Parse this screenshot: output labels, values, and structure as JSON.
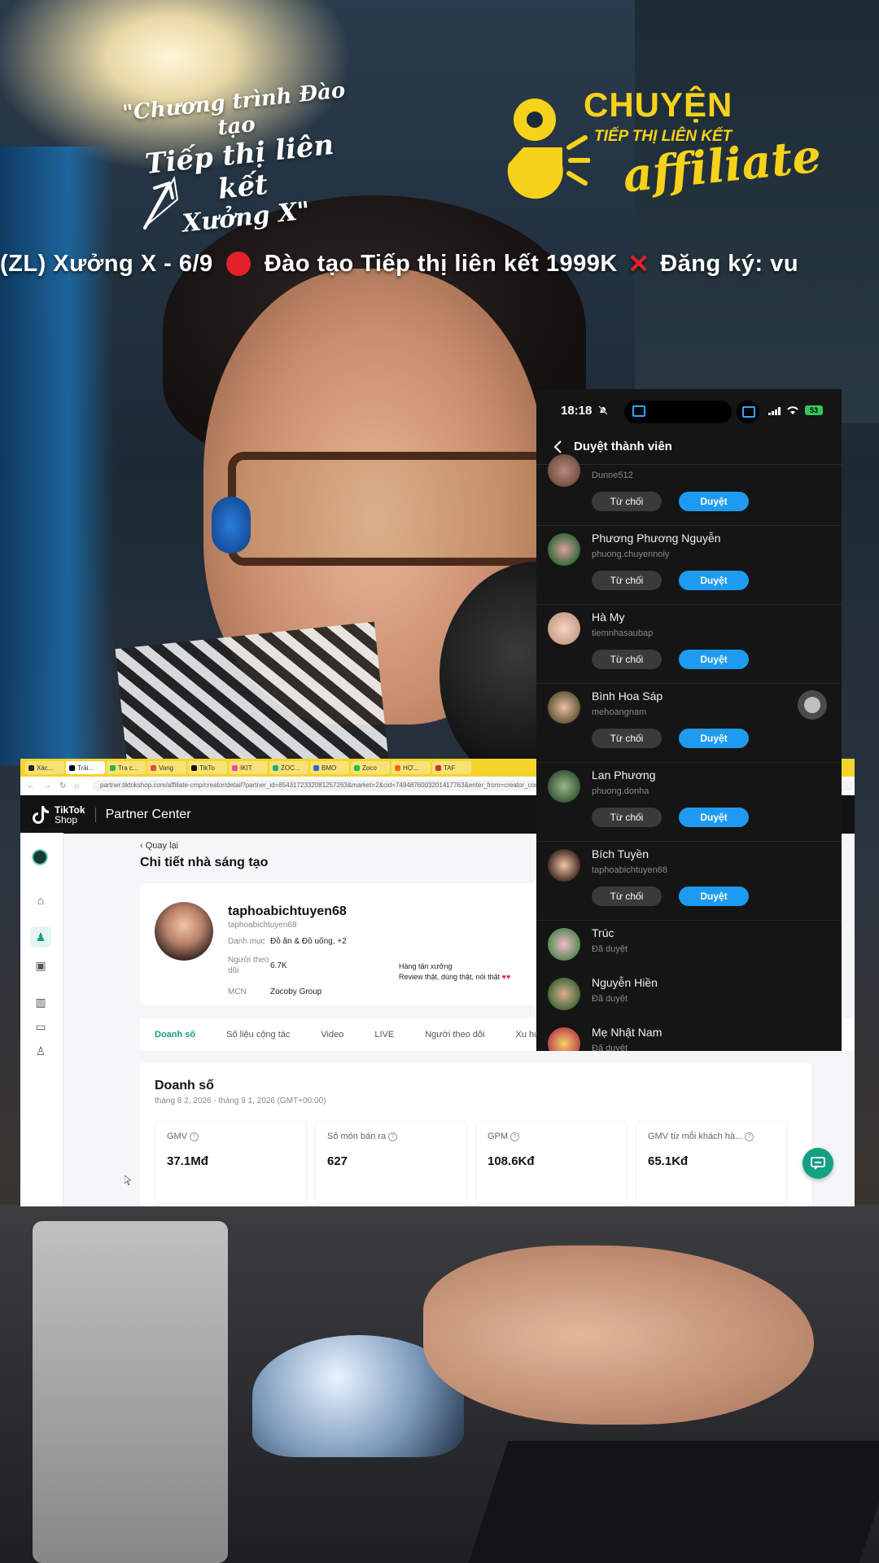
{
  "overlay": {
    "program_line1": "\"Chương trình Đào tạo",
    "program_line2": "Tiếp thị liên kết",
    "program_line3": "Xưởng X\"",
    "brand_title": "CHUYỆN",
    "brand_subtitle": "TIẾP THỊ LIÊN KẾT",
    "brand_script": "affiliate",
    "ticker_part1": "(ZL)    Xưởng X - 6/9",
    "ticker_part2": "Đào tạo Tiếp thị liên kết 1999K",
    "ticker_part3": "Đăng ký: vu",
    "accent_color": "#f6d21a"
  },
  "browser": {
    "tabs": [
      "Xác...",
      "Trải...",
      "Tra c...",
      "Vang",
      "TikTo",
      "IKIT",
      "ZOC...",
      "BMO",
      "Zoco",
      "HỢ...",
      "TAF"
    ],
    "url": "partner.tiktokshop.com/affiliate-cmp/creator/detail?partner_id=8543172332081257263&market=2&cid=7494876003201417763&enter_from=creator_connect_list",
    "partner_center": "Partner Center",
    "tiktok_word1": "TikTok",
    "tiktok_word2": "Shop",
    "back_label": "Quay lại",
    "page_title": "Chi tiết nhà sáng tạo",
    "profile": {
      "name": "taphoabichtuyen68",
      "handle": "taphoabichtuyen68",
      "category_label": "Danh mục",
      "category_value": "Đồ ăn & Đồ uống, +2",
      "followers_label": "Người theo dõi",
      "followers_value": "6.7K",
      "mcn_label": "MCN",
      "mcn_value": "Zocoby Group",
      "bio_line1": "Hàng tận xưởng",
      "bio_line2": "Review thật, dùng thật, nói thật"
    },
    "tabs_nav": [
      "Doanh số",
      "Số liệu cộng tác",
      "Video",
      "LIVE",
      "Người theo dõi",
      "Xu hướ"
    ],
    "sales": {
      "title": "Doanh số",
      "range": "tháng 8 2, 2026 - tháng 9 1, 2026 (GMT+00:00)",
      "metrics": [
        {
          "label": "GMV",
          "value": "37.1Mđ"
        },
        {
          "label": "Số món bán ra",
          "value": "627"
        },
        {
          "label": "GPM",
          "value": "108.6Kđ"
        },
        {
          "label": "GMV từ mỗi khách hà...",
          "value": "65.1Kđ"
        }
      ]
    },
    "accent_color": "#14a085"
  },
  "phone": {
    "time": "18:18",
    "battery": "53",
    "title": "Duyệt thành viên",
    "reject_label": "Từ chối",
    "approve_label": "Duyệt",
    "approved_label": "Đã duyệt",
    "pending": [
      {
        "name": "",
        "handle": "Dunne512"
      },
      {
        "name": "Phương Phương Nguyễn",
        "handle": "phuong.chuyennoiy"
      },
      {
        "name": "Hà My",
        "handle": "tiemnhasaubap"
      },
      {
        "name": "Bình Hoa Sáp",
        "handle": "mehoangnam"
      },
      {
        "name": "Lan Phương",
        "handle": "phuong.donha"
      },
      {
        "name": "Bích Tuyền",
        "handle": "taphoabichtuyen68"
      }
    ],
    "approved": [
      {
        "name": "Trúc"
      },
      {
        "name": "Nguyễn Hiền"
      },
      {
        "name": "Mẹ Nhật Nam"
      }
    ],
    "approve_color": "#1e9bf0"
  }
}
